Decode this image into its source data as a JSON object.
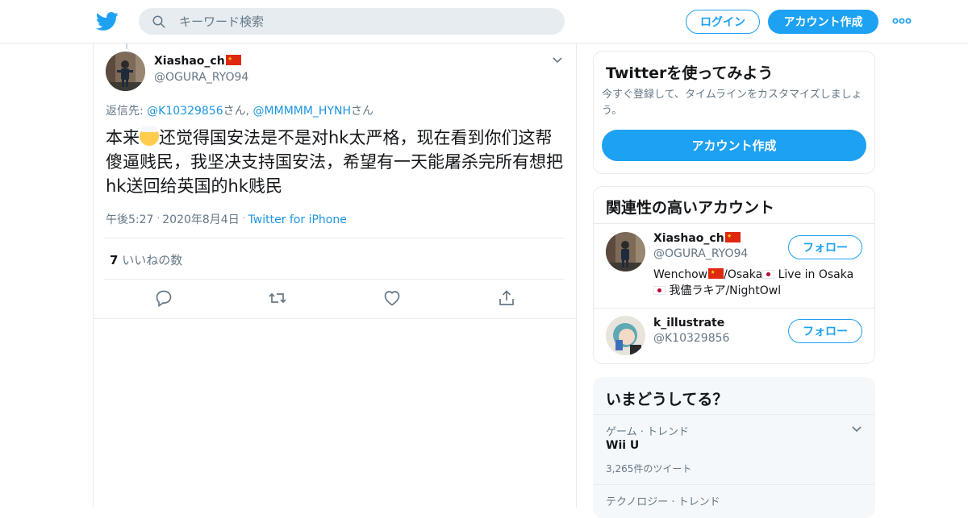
{
  "nav": {
    "search_placeholder": "キーワード検索",
    "login_label": "ログイン",
    "signup_label": "アカウント作成"
  },
  "tweet": {
    "name": "Xiashao_ch",
    "handle": "@OGURA_RYO94",
    "reply_prefix": "返信先: ",
    "reply_to": [
      {
        "handle": "@K10329856",
        "suffix": "さん"
      },
      {
        "handle": "@MMMMM_HYNH",
        "suffix": "さん"
      }
    ],
    "reply_separator": ", ",
    "text_before_emoji": "本来",
    "text_after_emoji": "还觉得国安法是不是对hk太严格，现在看到你们这帮傻逼贱民，我坚决支持国安法，希望有一天能屠杀完所有想把hk送回给英国的hk贱民",
    "time": "午後5:27",
    "date": "2020年8月4日",
    "source": "Twitter for iPhone",
    "likes_count": "7",
    "likes_label": "いいねの数"
  },
  "signup_card": {
    "title": "Twitterを使ってみよう",
    "description": "今すぐ登録して、タイムラインをカスタマイズしましょう。",
    "button": "アカウント作成"
  },
  "related": {
    "title": "関連性の高いアカウント",
    "follow_label": "フォロー",
    "accounts": [
      {
        "name": "Xiashao_ch",
        "handle": "@OGURA_RYO94",
        "bio_part1": "Wenchow",
        "bio_part2": "/Osaka",
        "bio_part3": " Live in Osaka",
        "bio_part4": " 我儘ラキア/NightOwl"
      },
      {
        "name": "k_illustrate",
        "handle": "@K10329856"
      }
    ]
  },
  "trends": {
    "title": "いまどうしてる？",
    "items": [
      {
        "category": "ゲーム · トレンド",
        "name": "Wii U",
        "count": "3,265件のツイート"
      },
      {
        "category": "テクノロジー · トレンド",
        "name": "",
        "count": ""
      }
    ]
  },
  "colors": {
    "accent": "#1da1f2",
    "link": "#1b95e0",
    "muted": "#657786",
    "border": "#e6ecf0"
  },
  "icons": [
    "twitter-logo-icon",
    "search-icon",
    "more-icon",
    "chevron-down-icon",
    "reply-icon",
    "retweet-icon",
    "like-icon",
    "share-icon"
  ]
}
